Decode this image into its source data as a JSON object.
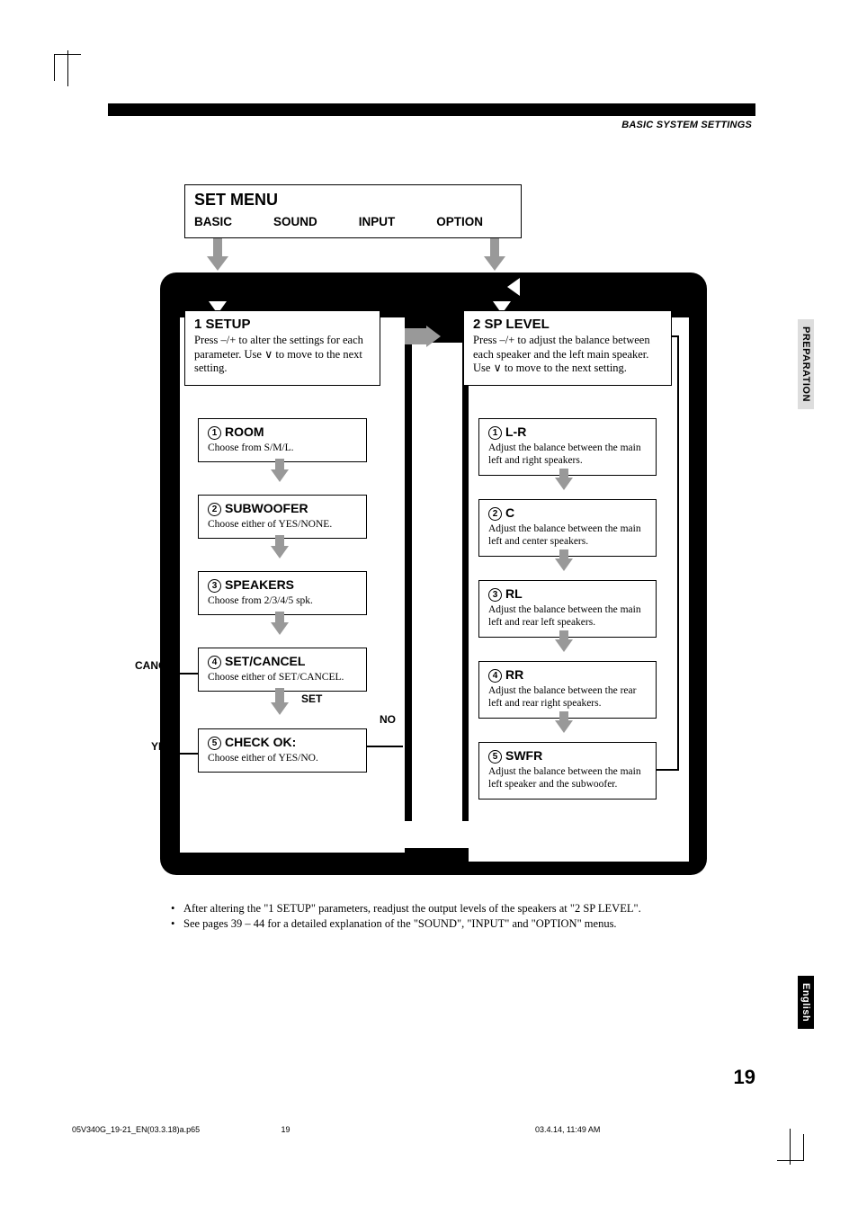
{
  "header": {
    "section": "BASIC SYSTEM SETTINGS"
  },
  "side_tabs": {
    "preparation": "PREPARATION",
    "language": "English"
  },
  "set_menu": {
    "title": "SET MENU",
    "tabs": [
      "BASIC",
      "SOUND",
      "INPUT",
      "OPTION"
    ]
  },
  "setup": {
    "title": "1   SETUP",
    "desc": "Press –/+ to alter the settings for each parameter. Use ∨ to move to the next setting.",
    "items": [
      {
        "num": "1",
        "title": "ROOM",
        "desc": "Choose from S/M/L."
      },
      {
        "num": "2",
        "title": "SUBWOOFER",
        "desc": "Choose either of YES/NONE."
      },
      {
        "num": "3",
        "title": "SPEAKERS",
        "desc": "Choose from 2/3/4/5 spk."
      },
      {
        "num": "4",
        "title": "SET/CANCEL",
        "desc": "Choose either of SET/CANCEL."
      },
      {
        "num": "5",
        "title": "CHECK OK:",
        "desc": "Choose either of YES/NO."
      }
    ]
  },
  "splevel": {
    "title": "2   SP LEVEL",
    "desc": "Press –/+ to adjust the balance between each speaker and the left main speaker. Use ∨ to move to the next setting.",
    "items": [
      {
        "num": "1",
        "title": "L-R",
        "desc": "Adjust the balance between the main left and right speakers."
      },
      {
        "num": "2",
        "title": "C",
        "desc": "Adjust the balance between the main left and center speakers."
      },
      {
        "num": "3",
        "title": "RL",
        "desc": "Adjust the balance between the main left and rear left speakers."
      },
      {
        "num": "4",
        "title": "RR",
        "desc": "Adjust the balance between the rear left and rear right speakers."
      },
      {
        "num": "5",
        "title": "SWFR",
        "desc": "Adjust the balance between the main left speaker and the subwoofer."
      }
    ]
  },
  "labels": {
    "cancel": "CANCEL",
    "set": "SET",
    "yes": "YES",
    "no": "NO"
  },
  "notes": [
    "After altering the \"1 SETUP\" parameters, readjust the output levels of the speakers at \"2 SP LEVEL\".",
    "See pages 39 – 44 for a detailed explanation of the \"SOUND\", \"INPUT\" and \"OPTION\" menus."
  ],
  "page_number": "19",
  "footer": {
    "filename": "05V340G_19-21_EN(03.3.18)a.p65",
    "page": "19",
    "datetime": "03.4.14, 11:49 AM"
  }
}
